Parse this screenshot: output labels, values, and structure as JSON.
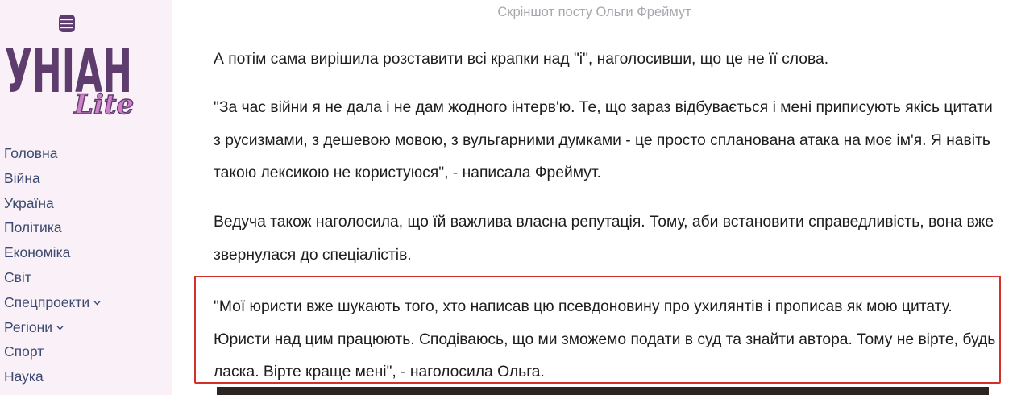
{
  "logo": {
    "main_text": "УНІАН",
    "sub_text": "Lite"
  },
  "sidebar": {
    "items": [
      {
        "label": "Головна",
        "has_dropdown": false
      },
      {
        "label": "Війна",
        "has_dropdown": false
      },
      {
        "label": "Україна",
        "has_dropdown": false
      },
      {
        "label": "Політика",
        "has_dropdown": false
      },
      {
        "label": "Економіка",
        "has_dropdown": false
      },
      {
        "label": "Світ",
        "has_dropdown": false
      },
      {
        "label": "Спецпроекти",
        "has_dropdown": true
      },
      {
        "label": "Регіони",
        "has_dropdown": true
      },
      {
        "label": "Спорт",
        "has_dropdown": false
      },
      {
        "label": "Наука",
        "has_dropdown": false
      }
    ]
  },
  "article": {
    "caption": "Скріншот посту Ольги Фреймут",
    "paragraphs": [
      "А потім сама вирішила розставити всі крапки над \"і\", наголосивши, що це не її слова.",
      "\"За час війни я не дала і не дам жодного інтерв'ю. Те, що зараз відбувається і мені приписують якісь цитати з русизмами, з дешевою мовою, з вульгарними думками - це просто спланована атака на моє ім'я. Я навіть такою лексикою не користуюся\", - написала Фреймут.",
      "Ведуча також наголосила, що їй важлива власна репутація. Тому, аби встановити справедливість, вона вже звернулася до спеціалістів.",
      "\"Мої юристи вже шукають того, хто написав цю псевдоновину про ухилянтів і прописав як мою цитату. Юристи над цим працюють. Сподіваюсь, що ми зможемо подати в суд та знайти автора. Тому не вірте, будь ласка. Вірте краще мені\", - наголосила Ольга."
    ]
  },
  "colors": {
    "sidebar_bg": "#faf1f8",
    "logo_purple": "#5e3d6e",
    "logo_pink": "#d080c8",
    "nav_text": "#3a4a70",
    "highlight_border": "#d3302b",
    "caption_text": "#a7a7ae"
  },
  "icons": {
    "dropdown": "chevron-down-icon",
    "logo_mic": "microphone-icon"
  }
}
